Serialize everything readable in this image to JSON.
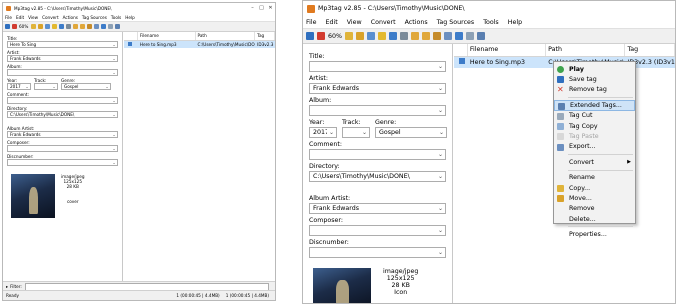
{
  "left_window": {
    "title": "Mp3tag v2.85 - C:\\Users\\Timothy\\Music\\DONE\\",
    "menu": [
      "File",
      "Edit",
      "View",
      "Convert",
      "Actions",
      "Tag Sources",
      "Tools",
      "Help"
    ],
    "toolbar": {
      "zoom": "60%"
    },
    "fields": {
      "title_label": "Title:",
      "title_value": "Here To Sing",
      "artist_label": "Artist:",
      "artist_value": "Frank Edwards",
      "album_label": "Album:",
      "album_value": "",
      "year_label": "Year:",
      "year_value": "2017",
      "track_label": "Track:",
      "track_value": "",
      "genre_label": "Genre:",
      "genre_value": "Gospel",
      "comment_label": "Comment:",
      "comment_value": "",
      "directory_label": "Directory:",
      "directory_value": "C:\\Users\\Timothy\\Music\\DONE\\",
      "album_artist_label": "Album Artist:",
      "album_artist_value": "Frank Edwards",
      "composer_label": "Composer:",
      "composer_value": "",
      "discnumber_label": "Discnumber:",
      "discnumber_value": ""
    },
    "cover": {
      "mime": "image/jpeg",
      "size": "125x125",
      "filesize": "28 KB",
      "type": "cover"
    },
    "columns": [
      "Filename",
      "Path",
      "Tag"
    ],
    "rows": [
      {
        "filename": "Here to Sing.mp3",
        "path": "C:\\Users\\Timothy\\Music\\DONE\\",
        "tag": "ID3v2.3"
      }
    ],
    "filter_label": "Filter:",
    "status": {
      "left": "Ready",
      "right1": "1 (00:00:45 | 4.4MB)",
      "right2": "1 (00:00:45 | 4.4MB)"
    }
  },
  "right_window": {
    "title": "Mp3tag v2.85 - C:\\Users\\Timothy\\Music\\DONE\\",
    "menu": [
      "File",
      "Edit",
      "View",
      "Convert",
      "Actions",
      "Tag Sources",
      "Tools",
      "Help"
    ],
    "toolbar": {
      "zoom": "60%"
    },
    "fields": {
      "title_label": "Title:",
      "title_value": "",
      "artist_label": "Artist:",
      "artist_value": "Frank Edwards",
      "album_label": "Album:",
      "album_value": "",
      "year_label": "Year:",
      "year_value": "2017",
      "track_label": "Track:",
      "track_value": "",
      "genre_label": "Genre:",
      "genre_value": "Gospel",
      "comment_label": "Comment:",
      "comment_value": "",
      "directory_label": "Directory:",
      "directory_value": "C:\\Users\\Timothy\\Music\\DONE\\",
      "album_artist_label": "Album Artist:",
      "album_artist_value": "Frank Edwards",
      "composer_label": "Composer:",
      "composer_value": "",
      "discnumber_label": "Discnumber:",
      "discnumber_value": ""
    },
    "cover": {
      "mime": "image/jpeg",
      "size": "125x125",
      "filesize": "28 KB",
      "type": "Icon"
    },
    "columns": [
      "Filename",
      "Path",
      "Tag"
    ],
    "rows": [
      {
        "filename": "Here to Sing.mp3",
        "path": "C:\\Users\\Timothy\\Music\\DONE\\",
        "tag": "ID3v2.3 (ID3v1"
      }
    ],
    "context_menu": [
      {
        "label": "Play",
        "icon": "play-icon",
        "bold": true,
        "disabled": false,
        "highlighted": false,
        "submenu": false
      },
      {
        "label": "Save tag",
        "icon": "save-icon",
        "bold": false,
        "disabled": false,
        "highlighted": false,
        "submenu": false
      },
      {
        "label": "Remove tag",
        "icon": "remove-icon",
        "bold": false,
        "disabled": false,
        "highlighted": false,
        "submenu": false
      },
      {
        "label": "Extended Tags...",
        "icon": "extended-tags-icon",
        "bold": false,
        "disabled": false,
        "highlighted": true,
        "submenu": false
      },
      {
        "label": "Tag Cut",
        "icon": "cut-icon",
        "bold": false,
        "disabled": false,
        "highlighted": false,
        "submenu": false
      },
      {
        "label": "Tag Copy",
        "icon": "copy-icon",
        "bold": false,
        "disabled": false,
        "highlighted": false,
        "submenu": false
      },
      {
        "label": "Tag Paste",
        "icon": "paste-icon",
        "bold": false,
        "disabled": true,
        "highlighted": false,
        "submenu": false
      },
      {
        "label": "Export...",
        "icon": "export-icon",
        "bold": false,
        "disabled": false,
        "highlighted": false,
        "submenu": false
      },
      {
        "label": "Convert",
        "icon": "",
        "bold": false,
        "disabled": false,
        "highlighted": false,
        "submenu": true
      },
      {
        "label": "Rename",
        "icon": "",
        "bold": false,
        "disabled": false,
        "highlighted": false,
        "submenu": false
      },
      {
        "label": "Copy...",
        "icon": "copy-file-icon",
        "bold": false,
        "disabled": false,
        "highlighted": false,
        "submenu": false
      },
      {
        "label": "Move...",
        "icon": "move-icon",
        "bold": false,
        "disabled": false,
        "highlighted": false,
        "submenu": false
      },
      {
        "label": "Remove",
        "icon": "",
        "bold": false,
        "disabled": false,
        "highlighted": false,
        "submenu": false
      },
      {
        "label": "Delete...",
        "icon": "",
        "bold": false,
        "disabled": false,
        "highlighted": false,
        "submenu": false
      },
      {
        "label": "Properties...",
        "icon": "",
        "bold": false,
        "disabled": false,
        "highlighted": false,
        "submenu": false
      }
    ],
    "context_separators_after": [
      2,
      7,
      8,
      13
    ]
  },
  "colors": {
    "selection": "#cce4fb",
    "menu_highlight": "#cfe3f7",
    "toolbar_bg": "#f0f0f0",
    "app_icon": "#e07a1f"
  }
}
